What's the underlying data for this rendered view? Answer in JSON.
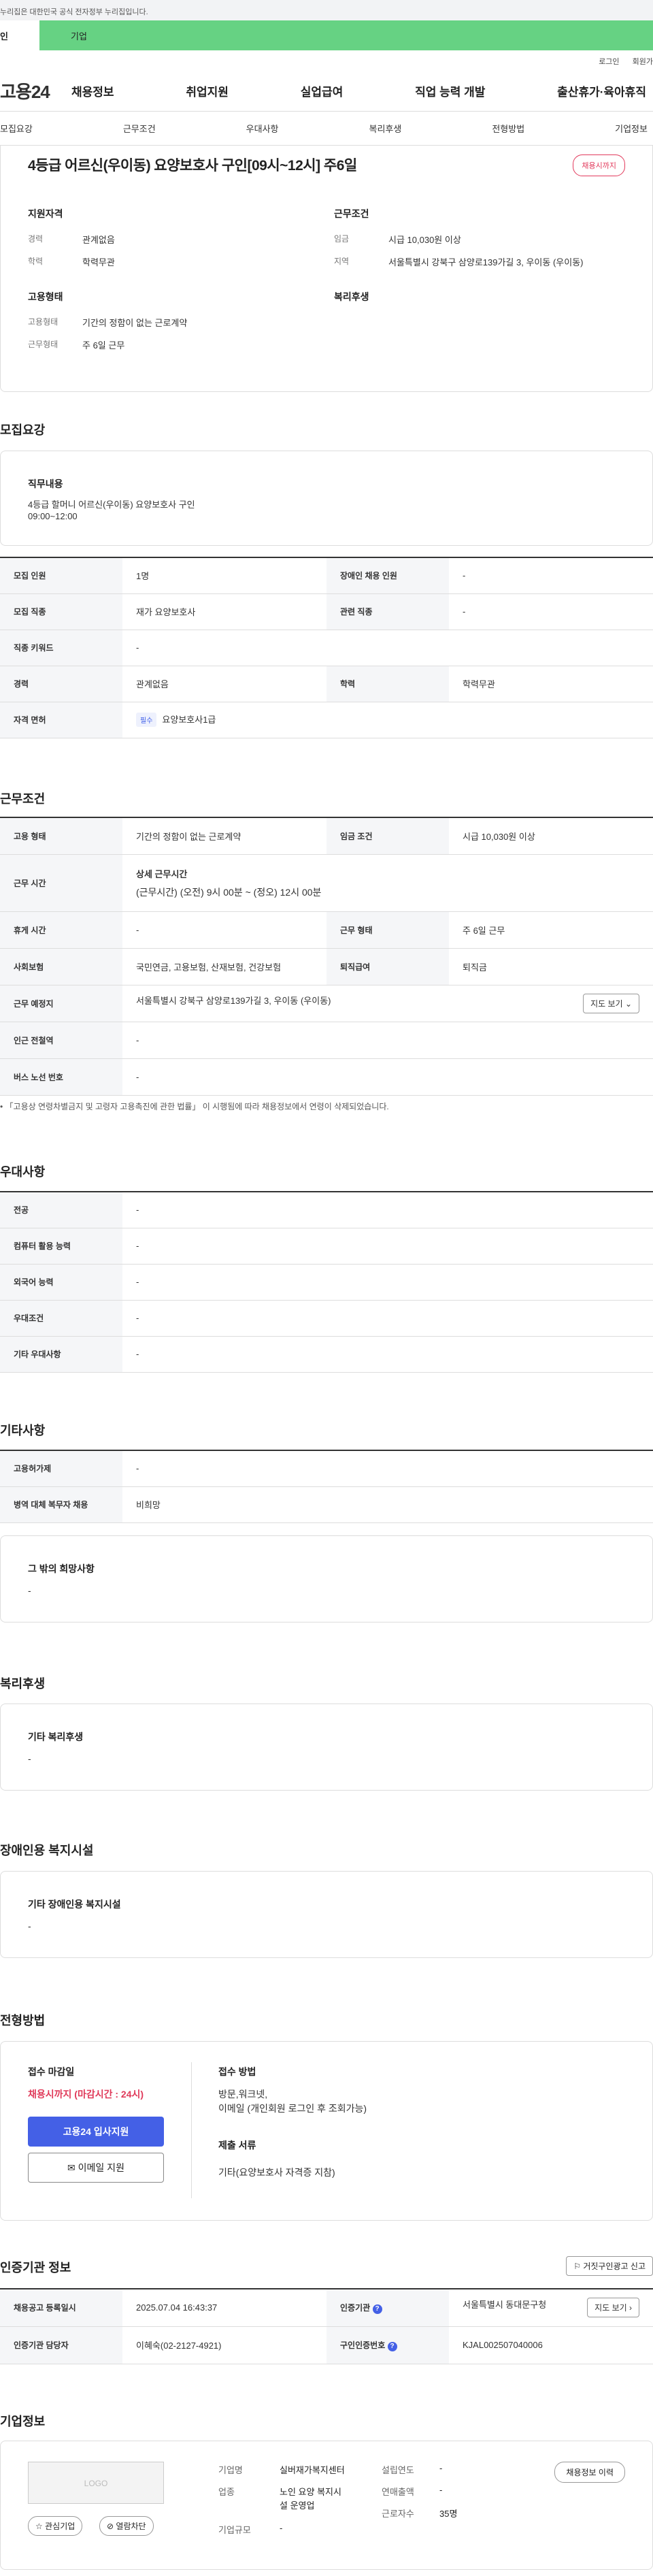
{
  "top_notice": "누리집은 대한민국 공식 전자정부 누리집입니다.",
  "tabs": {
    "personal": "인",
    "company": "기업"
  },
  "util": {
    "login": "로그인",
    "signup": "회원가"
  },
  "gnb": {
    "logo": "고용24",
    "menu": [
      "채용정보",
      "취업지원",
      "실업급여",
      "직업 능력 개발",
      "출산휴가·육아휴직"
    ]
  },
  "subnav": [
    "모집요강",
    "근무조건",
    "우대사항",
    "복리후생",
    "전형방법",
    "기업정보"
  ],
  "summary": {
    "title": "4등급 어르신(우이동) 요양보호사 구인[09시~12시] 주6일",
    "badge": "채용시까지",
    "qual": {
      "heading": "지원자격",
      "career_k": "경력",
      "career_v": "관계없음",
      "edu_k": "학력",
      "edu_v": "학력무관"
    },
    "cond": {
      "heading": "근무조건",
      "wage_k": "임금",
      "wage_v": "시급 10,030원 이상",
      "region_k": "지역",
      "region_v": "서울특별시 강북구 삼양로139가길 3, 우이동 (우이동)"
    },
    "emp": {
      "heading": "고용형태",
      "type_k": "고용형태",
      "type_v": "기간의 정함이 없는 근로계약",
      "form_k": "근무형태",
      "form_v": "주 6일 근무"
    },
    "welfare": {
      "heading": "복리후생"
    }
  },
  "recruit": {
    "heading": "모집요강",
    "duty_title": "직무내용",
    "duty_line1": "4등급 할머니 어르신(우이동) 요양보호사 구인",
    "duty_line2": "09:00~12:00",
    "rows": {
      "count_k": "모집 인원",
      "count_v": "1명",
      "disabled_k": "장애인 채용 인원",
      "disabled_v": "-",
      "job_k": "모집 직종",
      "job_v": "재가 요양보호사",
      "rel_k": "관련 직종",
      "rel_v": "-",
      "kw_k": "직종 키워드",
      "kw_v": "-",
      "career_k": "경력",
      "career_v": "관계없음",
      "edu_k": "학력",
      "edu_v": "학력무관",
      "lic_k": "자격 면허",
      "lic_tag": "필수",
      "lic_v": "요양보호사1급"
    }
  },
  "work": {
    "heading": "근무조건",
    "type_k": "고용 형태",
    "type_v": "기간의 정함이 없는 근로계약",
    "wage_k": "임금 조건",
    "wage_v": "시급 10,030원 이상",
    "hours_k": "근무 시간",
    "hours_title": "상세 근무시간",
    "hours_v": "(근무시간) (오전) 9시 00분 ~ (정오) 12시 00분",
    "rest_k": "휴게 시간",
    "rest_v": "-",
    "form_k": "근무 형태",
    "form_v": "주 6일 근무",
    "ins_k": "사회보험",
    "ins_v": "국민연금, 고용보험, 산재보험, 건강보험",
    "ret_k": "퇴직급여",
    "ret_v": "퇴직금",
    "place_k": "근무 예정지",
    "place_v": "서울특별시 강북구 삼양로139가길 3, 우이동 (우이동)",
    "map_btn": "지도 보기",
    "subway_k": "인근 전철역",
    "subway_v": "-",
    "bus_k": "버스 노선 번호",
    "bus_v": "-",
    "note": "「고용상 연령차별금지 및 고령자 고용촉진에 관한 법률」 이 시행됨에 따라 채용정보에서 연령이 삭제되었습니다."
  },
  "pref": {
    "heading": "우대사항",
    "rows": [
      {
        "k": "전공",
        "v": "-"
      },
      {
        "k": "컴퓨터 활용 능력",
        "v": "-"
      },
      {
        "k": "외국어 능력",
        "v": "-"
      },
      {
        "k": "우대조건",
        "v": "-"
      },
      {
        "k": "기타 우대사항",
        "v": "-"
      }
    ]
  },
  "etc": {
    "heading": "기타사항",
    "rows": [
      {
        "k": "고용허가제",
        "v": "-"
      },
      {
        "k": "병역 대체 복무자 채용",
        "v": "비희망"
      }
    ],
    "hope_title": "그 밖의 희망사항",
    "hope_v": "-"
  },
  "welfare": {
    "heading": "복리후생",
    "title": "기타 복리후생",
    "v": "-"
  },
  "facility": {
    "heading": "장애인용 복지시설",
    "title": "기타 장애인용 복지시설",
    "v": "-"
  },
  "apply": {
    "heading": "전형방법",
    "deadline_title": "접수 마감일",
    "deadline_v": "채용시까지 (마감시간 : 24시)",
    "apply_btn": "고용24 입사지원",
    "email_btn": "이메일 지원",
    "method_title": "접수 방법",
    "method_v1": "방문,워크넷,",
    "method_v2": "이메일 (개인회원 로그인 후 조회가능)",
    "doc_title": "제출 서류",
    "doc_v": "기타(요양보호사 자격증 지참)"
  },
  "agency": {
    "heading": "인증기관 정보",
    "report_btn": "거짓구인광고 신고",
    "reg_k": "채용공고 등록일시",
    "reg_v": "2025.07.04 16:43:37",
    "org_k": "인증기관",
    "org_v": "서울특별시 동대문구청",
    "map_btn": "지도 보기",
    "mgr_k": "인증기관 담당자",
    "mgr_v": "이혜숙(02-2127-4921)",
    "no_k": "구인인증번호",
    "no_v": "KJAL002507040006"
  },
  "company": {
    "heading": "기업정보",
    "logo": "LOGO",
    "fav_btn": "관심기업",
    "block_btn": "열람차단",
    "name_k": "기업명",
    "name_v": "실버재가복지센터",
    "ind_k": "업종",
    "ind_v1": "노인 요양 복지시",
    "ind_v2": "설 운영업",
    "size_k": "기업규모",
    "size_v": "-",
    "year_k": "설립연도",
    "year_v": "-",
    "sales_k": "연매출액",
    "sales_v": "-",
    "emp_k": "근로자수",
    "emp_v": "35명",
    "history_btn": "채용정보 이력"
  }
}
